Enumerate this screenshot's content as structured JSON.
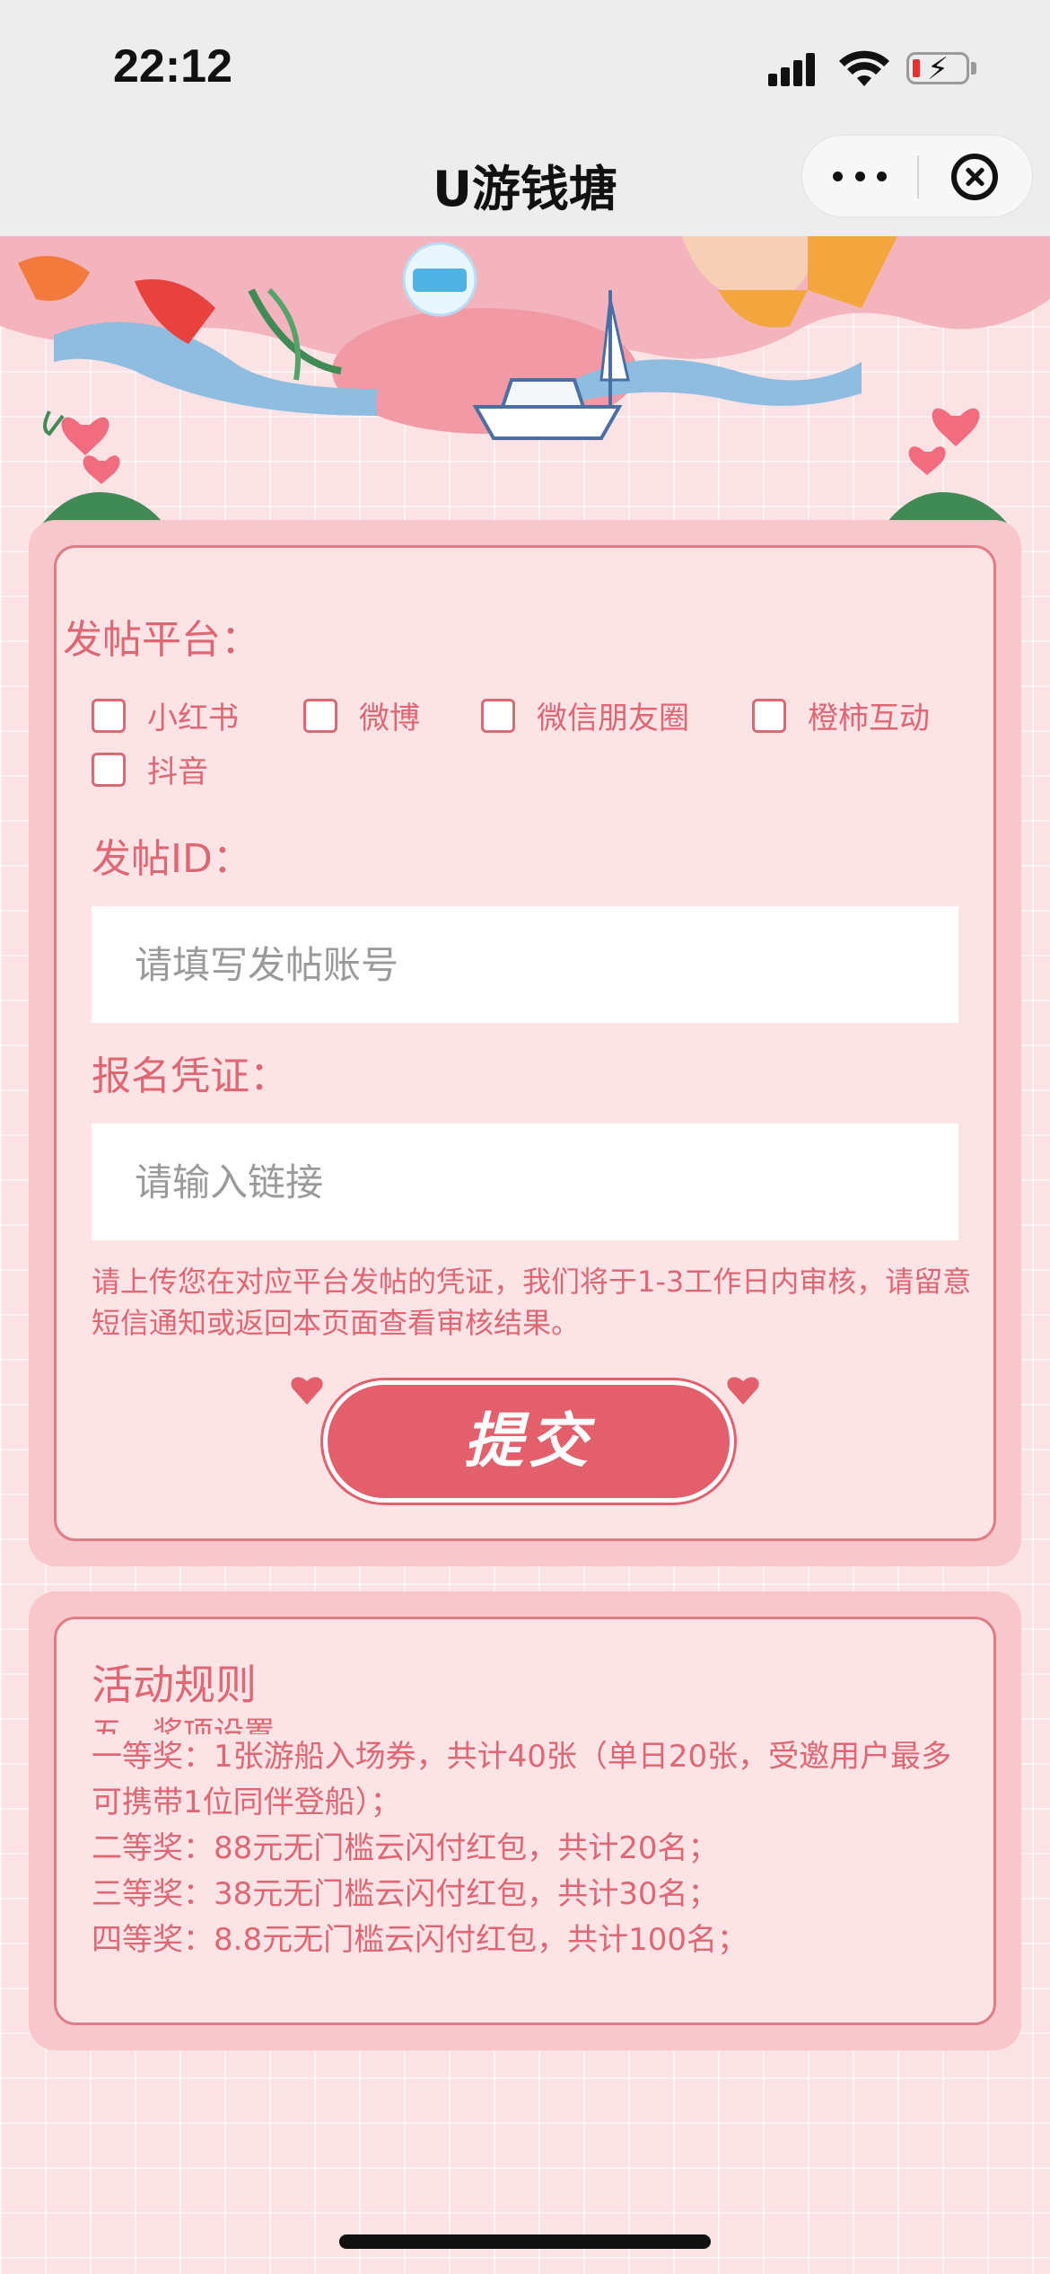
{
  "status_bar": {
    "time": "22:12"
  },
  "nav": {
    "title": "U游钱塘"
  },
  "form": {
    "platform_label": "发帖平台：",
    "platforms": [
      "小红书",
      "微博",
      "微信朋友圈",
      "橙柿互动",
      "抖音"
    ],
    "post_id_label": "发帖ID：",
    "post_id_placeholder": "请填写发帖账号",
    "proof_label": "报名凭证：",
    "proof_placeholder": "请输入链接",
    "hint": "请上传您在对应平台发帖的凭证，我们将于1-3工作日内审核，请留意短信通知或返回本页面查看审核结果。",
    "submit_label": "提交"
  },
  "rules": {
    "title": "活动规则",
    "cut_line": "五、奖项设置",
    "lines": [
      "一等奖：1张游船入场券，共计40张（单日20张，受邀用户最多可携带1位同伴登船）；",
      "二等奖：88元无门槛云闪付红包，共计20名；",
      "三等奖：38元无门槛云闪付红包，共计30名；",
      "四等奖：8.8元无门槛云闪付红包，共计100名；"
    ]
  },
  "colors": {
    "accent": "#e45f6c",
    "text": "#e06673",
    "card": "#fce4e6"
  }
}
